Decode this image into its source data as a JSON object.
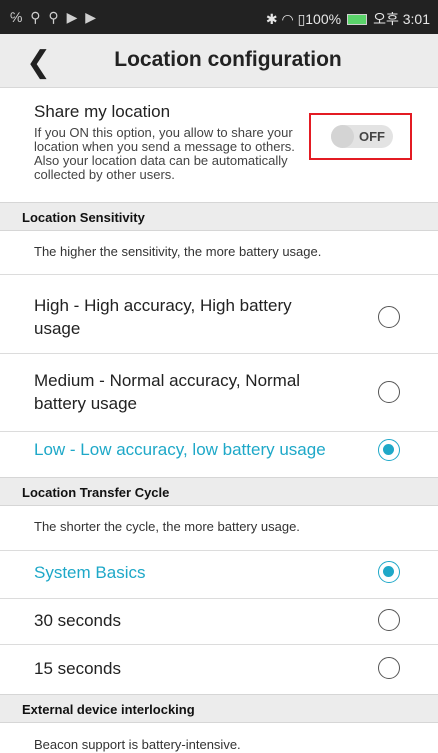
{
  "statusbar": {
    "left_icons": "℅ ⚲ ⚲ ▶ ▶",
    "right_text": "✱ ◠ ▯100%",
    "time": "오후 3:01"
  },
  "header": {
    "back_icon": "chevron-left",
    "title": "Location configuration"
  },
  "share": {
    "title": "Share my location",
    "description": "If you ON this option, you allow to share your location when you send a message to others. Also your location data can be automatically collected by other users.",
    "toggle_label": "OFF",
    "toggle_state": "off"
  },
  "sensitivity": {
    "section_title": "Location Sensitivity",
    "description": "The higher the sensitivity, the more battery usage.",
    "options": [
      {
        "label": "High - High accuracy, High battery usage",
        "selected": false
      },
      {
        "label": "Medium - Normal accuracy, Normal battery usage",
        "selected": false
      },
      {
        "label": "Low - Low accuracy, low battery usage",
        "selected": true
      }
    ]
  },
  "transfer": {
    "section_title": "Location Transfer Cycle",
    "description": "The shorter the cycle, the more battery usage.",
    "options": [
      {
        "label": "System Basics",
        "selected": true
      },
      {
        "label": "30 seconds",
        "selected": false
      },
      {
        "label": "15 seconds",
        "selected": false
      }
    ]
  },
  "external": {
    "section_title": "External device interlocking",
    "description": "Beacon support is battery-intensive."
  },
  "colors": {
    "accent": "#1ea8c8",
    "highlight_border": "#e31b23",
    "section_bg": "#ececec"
  }
}
